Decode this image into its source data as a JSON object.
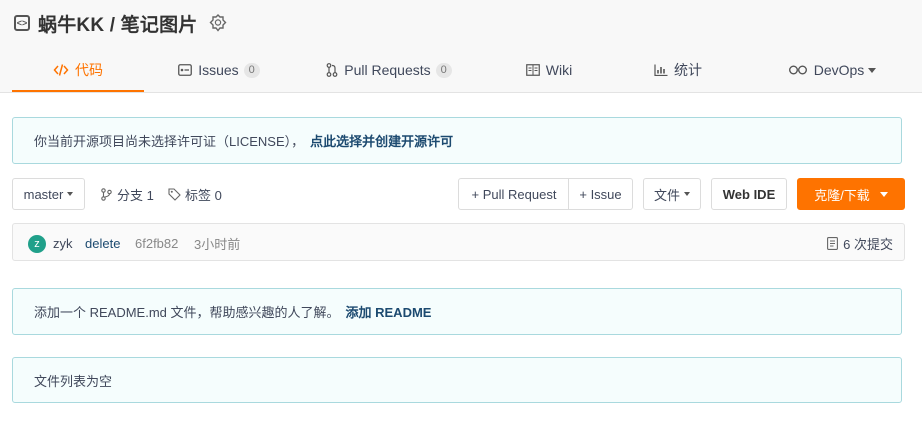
{
  "repo": {
    "title": "蜗牛KK / 笔记图片"
  },
  "tabs": [
    {
      "label": "代码",
      "icon": "code-icon",
      "active": true
    },
    {
      "label": "Issues",
      "count": "0",
      "icon": "issues-icon"
    },
    {
      "label": "Pull Requests",
      "count": "0",
      "icon": "pull-request-icon"
    },
    {
      "label": "Wiki",
      "icon": "wiki-icon"
    },
    {
      "label": "统计",
      "icon": "chart-icon"
    },
    {
      "label": "DevOps",
      "icon": "infinity-icon"
    }
  ],
  "license_notice": {
    "text": "你当前开源项目尚未选择许可证（LICENSE），",
    "link": "点此选择并创建开源许可"
  },
  "toolbar": {
    "branch": "master",
    "branches_label": "分支 1",
    "tags_label": "标签 0",
    "pull_request_label": "+ Pull Request",
    "issue_label": "+ Issue",
    "file_label": "文件",
    "webide_label": "Web IDE",
    "clone_label": "克隆/下载"
  },
  "commit": {
    "avatar_letter": "z",
    "author": "zyk",
    "message": "delete",
    "hash": "6f2fb82",
    "time": "3小时前",
    "commits_count": "6 次提交"
  },
  "readme_notice": {
    "text": "添加一个 README.md 文件，帮助感兴趣的人了解。",
    "link": "添加 README"
  },
  "empty_notice": {
    "text": "文件列表为空"
  },
  "colors": {
    "accent": "#fe7300",
    "notice_bg": "#f5fdfd",
    "notice_border": "#a9d9de",
    "avatar": "#20a08a"
  }
}
